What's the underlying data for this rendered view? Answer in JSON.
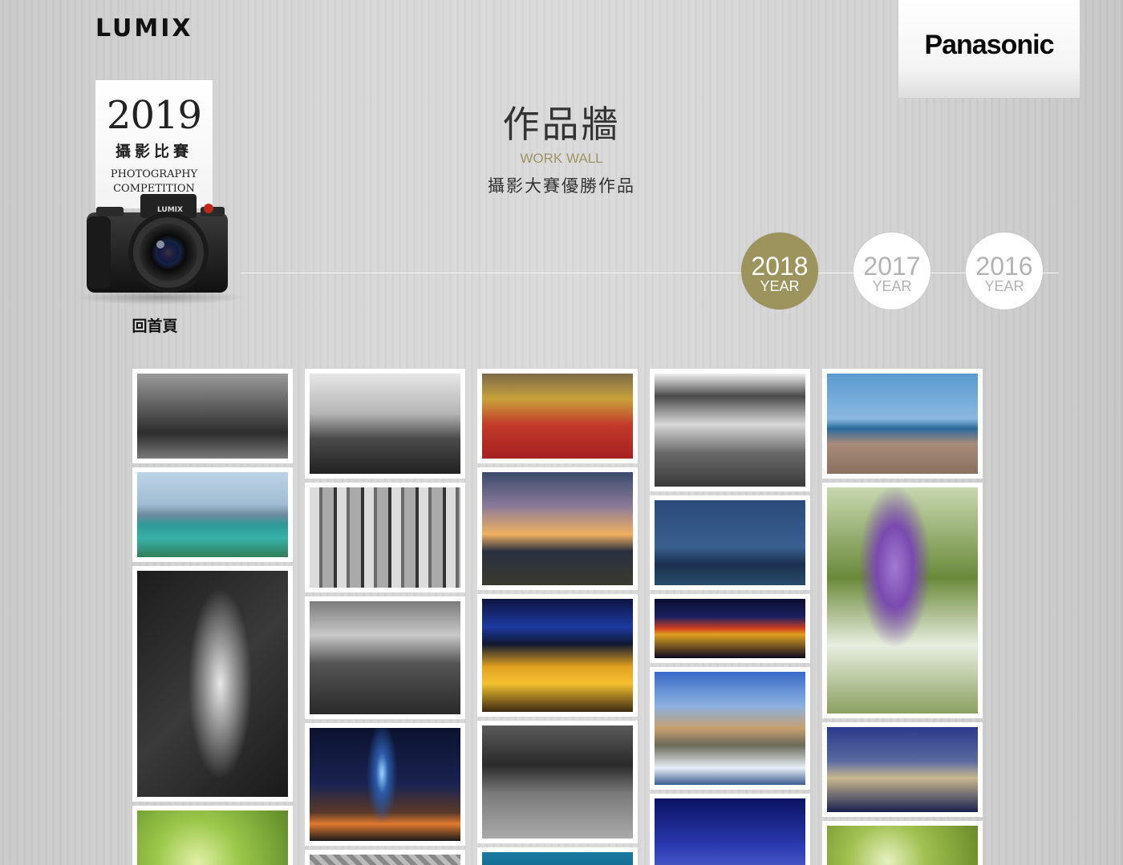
{
  "header": {
    "lumix_logo": "LUMIX",
    "brand_logo": "Panasonic"
  },
  "competition": {
    "year": "2019",
    "title_zh": "攝影比賽",
    "title_en_line1": "PHOTOGRAPHY",
    "title_en_line2": "COMPETITION",
    "camera_brand": "LUMIX",
    "home_label": "回首頁"
  },
  "hero": {
    "title": "作品牆",
    "title_en": "WORK WALL",
    "subtitle": "攝影大賽優勝作品"
  },
  "years": [
    {
      "year": "2018",
      "label": "YEAR",
      "active": true
    },
    {
      "year": "2017",
      "label": "YEAR",
      "active": false
    },
    {
      "year": "2016",
      "label": "YEAR",
      "active": false
    }
  ],
  "colors": {
    "accent": "#9c935d",
    "background": "#d4d4d4"
  },
  "gallery": {
    "columns": [
      {
        "tiles": [
          "street-bw",
          "harbor-city",
          "grass-bw",
          "green-macro"
        ]
      },
      {
        "tiles": [
          "wedding-bw",
          "ruins-bw",
          "market-bw",
          "taipei-101-night",
          "pattern-bw"
        ]
      },
      {
        "tiles": [
          "festival",
          "sunset-sea",
          "boats-night",
          "street-bw-2",
          "blue-sea"
        ]
      },
      {
        "tiles": [
          "memorial-bw",
          "foggy-shore",
          "night-river",
          "castle-snow",
          "starry-night"
        ]
      },
      {
        "tiles": [
          "coastal-town",
          "wisteria",
          "arches-night",
          "green-leaf"
        ]
      }
    ]
  }
}
